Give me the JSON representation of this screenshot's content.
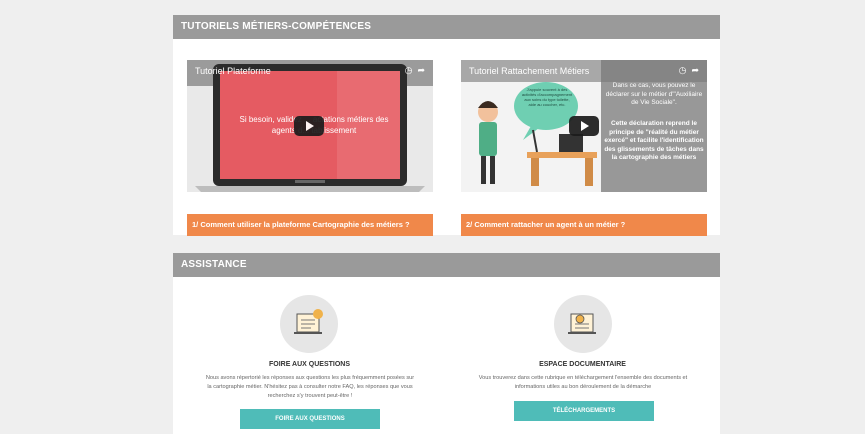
{
  "tutorials": {
    "heading": "TUTORIELS MÉTIERS-COMPÉTENCES",
    "videos": [
      {
        "title": "Tutoriel Plateforme",
        "overlay_text": "Si besoin, validez ... actations métiers des agents d... tablissement",
        "caption": "1/ Comment utiliser la plateforme Cartographie des métiers ?"
      },
      {
        "title": "Tutoriel Rattachement Métiers",
        "side_text_1": "Dans ce cas, vous pouvez le déclarer sur le métier d'\"Auxiliaire de Vie Sociale\".",
        "side_text_2": "Cette déclaration reprend le principe de \"réalité du métier exercé\" et facilite l'identification des glissements de tâches dans la cartographie des métiers",
        "bubble_text": "J'appuie souvent à des activités d'accompagnement aux soins du type toilette, aide au coucher, etc.",
        "caption": "2/ Comment rattacher un agent à un métier ?"
      }
    ]
  },
  "assistance": {
    "heading": "ASSISTANCE",
    "faq": {
      "title": "FOIRE AUX QUESTIONS",
      "text": "Nous avons répertorié les réponses aux questions les plus fréquemment posées sur la cartographie métier. N'hésitez pas à consulter notre FAQ, les réponses que vous recherchez s'y trouvent peut-être !",
      "button": "FOIRE AUX QUESTIONS"
    },
    "docs": {
      "title": "ESPACE DOCUMENTAIRE",
      "text": "Vous trouverez dans cette rubrique en téléchargement l'ensemble des documents et informations utiles au bon déroulement de la démarche",
      "button": "TÉLÉCHARGEMENTS"
    }
  }
}
